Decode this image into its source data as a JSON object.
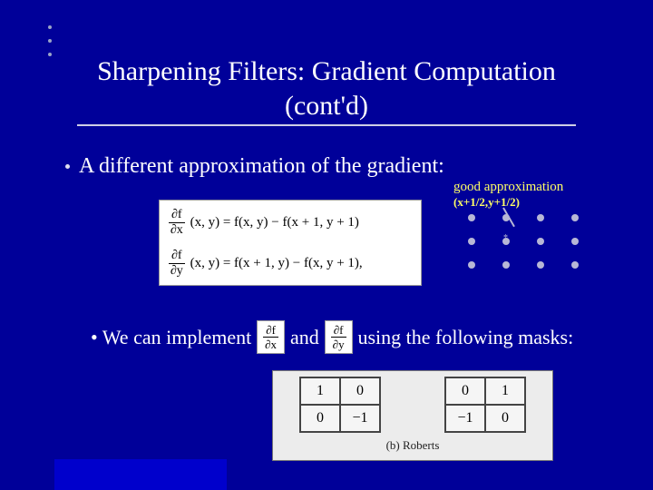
{
  "title": {
    "line1": "Sharpening Filters: Gradient Computation",
    "line2": "(cont'd)"
  },
  "bullet1": "A different approximation of the gradient:",
  "approx_note": {
    "line1": "good approximation",
    "line2": "(x+1/2,y+1/2)"
  },
  "equations": {
    "dfdx": {
      "num": "∂f",
      "den": "∂x",
      "args": "(x, y) = f(x, y) − f(x + 1, y + 1)"
    },
    "dfdy": {
      "num": "∂f",
      "den": "∂y",
      "args": "(x, y) = f(x + 1, y) − f(x, y + 1),"
    }
  },
  "implement": {
    "prefix": "• We can implement",
    "and": "and",
    "suffix": "using the following masks:",
    "p1": {
      "num": "∂f",
      "den": "∂x"
    },
    "p2": {
      "num": "∂f",
      "den": "∂y"
    }
  },
  "masks": {
    "left": [
      [
        "1",
        "0"
      ],
      [
        "0",
        "−1"
      ]
    ],
    "right": [
      [
        "0",
        "1"
      ],
      [
        "−1",
        "0"
      ]
    ],
    "caption": "(b) Roberts"
  }
}
